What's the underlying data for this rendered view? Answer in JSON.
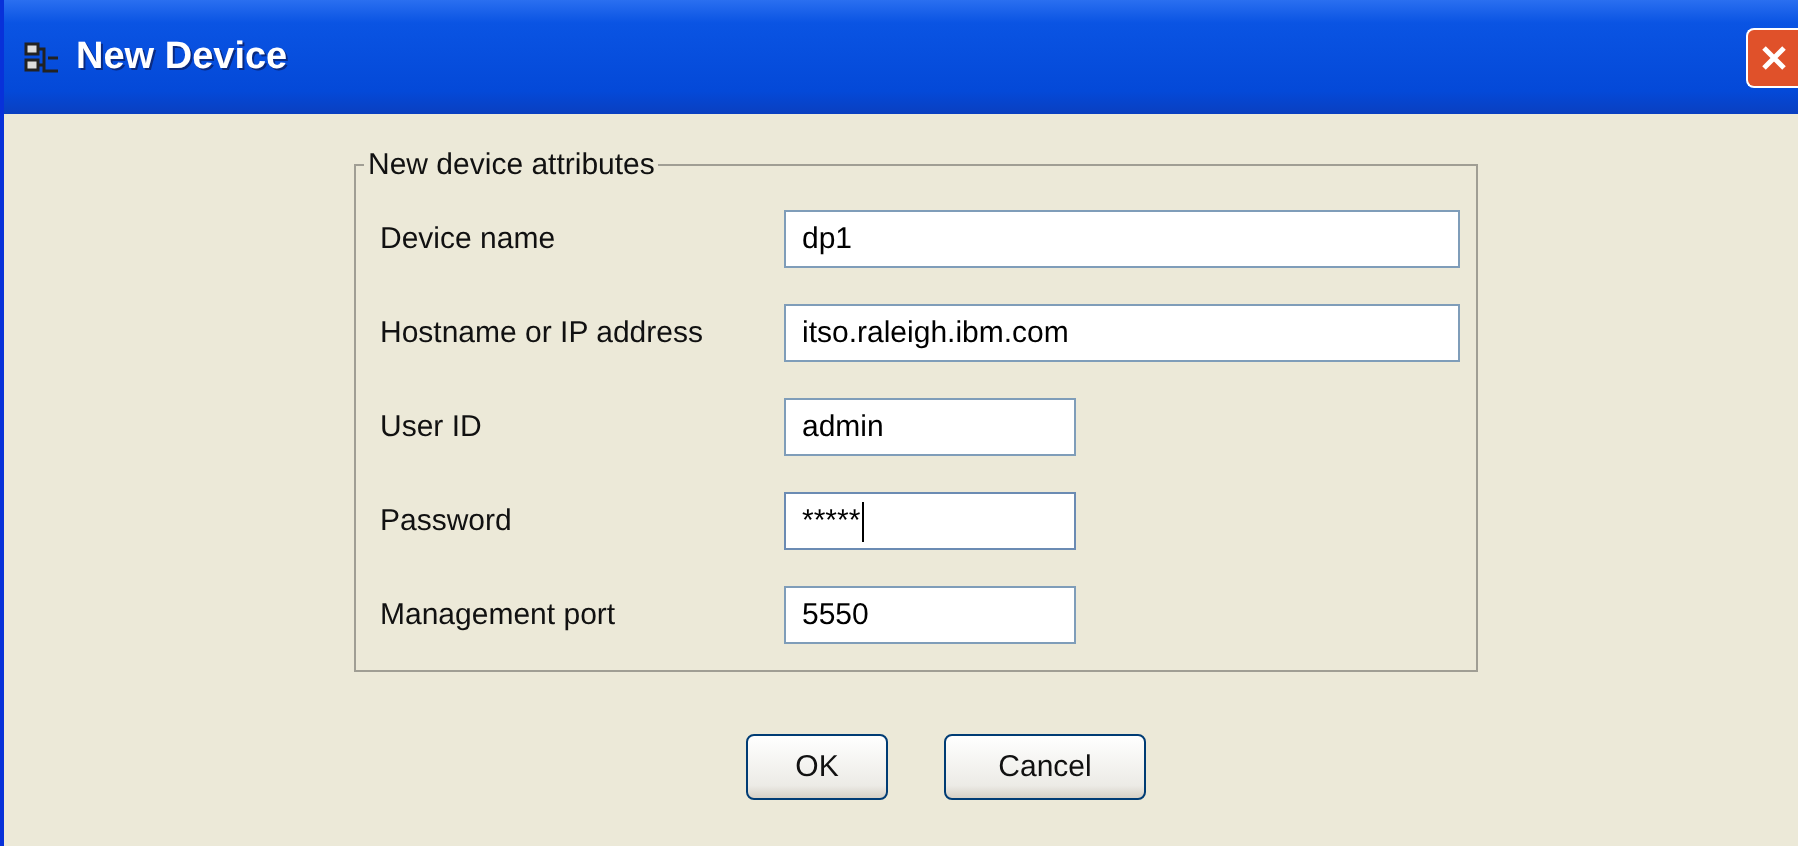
{
  "window": {
    "title": "New Device"
  },
  "group": {
    "title": "New device attributes"
  },
  "fields": [
    {
      "label": "Device name",
      "value": "dp1",
      "kind": "wide",
      "focused": false
    },
    {
      "label": "Hostname or IP address",
      "value": "itso.raleigh.ibm.com",
      "kind": "wide",
      "focused": false
    },
    {
      "label": "User ID",
      "value": "admin",
      "kind": "short",
      "focused": false
    },
    {
      "label": "Password",
      "value": "*****",
      "kind": "short",
      "focused": true
    },
    {
      "label": "Management port",
      "value": "5550",
      "kind": "short",
      "focused": false
    }
  ],
  "buttons": [
    "OK",
    "Cancel"
  ]
}
